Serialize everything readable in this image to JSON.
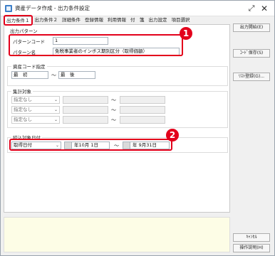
{
  "window": {
    "title": "資産データ作成 - 出力条件設定"
  },
  "tabs": [
    {
      "label": "出力条件１"
    },
    {
      "label": "出力条件２"
    },
    {
      "label": "詳細条件"
    },
    {
      "label": "登録情報"
    },
    {
      "label": "利用情報"
    },
    {
      "label": "付　箋"
    },
    {
      "label": "出力設定"
    },
    {
      "label": "項目選択"
    }
  ],
  "output_pattern": {
    "group_label": "出力パターン",
    "code_label": "パターンコード",
    "code_value": "1",
    "name_label": "パターン名",
    "name_value": "免税事業者のインボス期別区分（取得価額）"
  },
  "asset_code": {
    "group_label": "資産コード指定",
    "from_value": "最　初",
    "to_value": "最　後",
    "tilde": "～"
  },
  "aggregation": {
    "group_label": "集計対象",
    "rows": [
      {
        "select": "指定なし",
        "tilde": "～"
      },
      {
        "select": "指定なし",
        "tilde": "～"
      },
      {
        "select": "指定なし",
        "tilde": "～"
      }
    ]
  },
  "narrowing_date": {
    "group_label": "絞込対象日付",
    "select": "取得日付",
    "from_date": "年10月 1日",
    "to_date": "年 9月31日",
    "tilde": "～"
  },
  "side_buttons": [
    {
      "label": "出力開始(E)"
    },
    {
      "label": "ｺｰﾄﾞ保存(S)"
    },
    {
      "label": "ﾘｽﾄ登録(G)..."
    },
    {
      "label": "ｷｬﾝｾﾙ"
    },
    {
      "label": "操作説明(H)"
    }
  ],
  "annotations": [
    {
      "number": "1"
    },
    {
      "number": "2"
    }
  ],
  "colors": {
    "highlight": "#e3001b",
    "footer_background": "#fdfde6"
  }
}
